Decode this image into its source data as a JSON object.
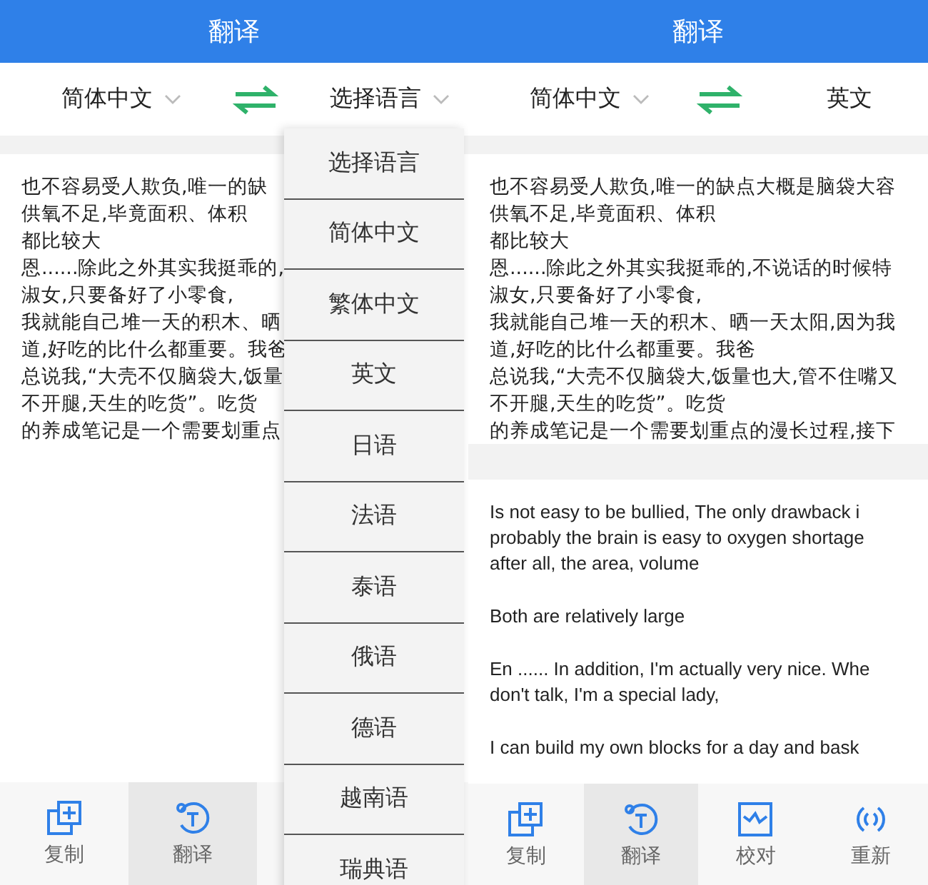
{
  "screens": [
    {
      "title": "翻译",
      "source_lang": {
        "label": "简体中文",
        "chevron": true
      },
      "target_lang": {
        "label": "选择语言",
        "chevron": true
      },
      "source_lines": [
        "也不容易受人欺负,唯一的缺",
        "供氧不足,毕竟面积、体积",
        "都比较大",
        "恩......除此之外其实我挺乖的,",
        "淑女,只要备好了小零食,",
        "我就能自己堆一天的积木、晒",
        "道,好吃的比什么都重要。我爸",
        "总说我,“大壳不仅脑袋大,饭量",
        "不开腿,天生的吃货”。吃货",
        "的养成笔记是一个需要划重点"
      ],
      "nav": [
        {
          "kind": "copy",
          "label": "复制",
          "selected": false
        },
        {
          "kind": "translate",
          "label": "翻译",
          "selected": true
        }
      ],
      "dropdown": [
        "选择语言",
        "简体中文",
        "繁体中文",
        "英文",
        "日语",
        "法语",
        "泰语",
        "俄语",
        "德语",
        "越南语",
        "瑞典语"
      ]
    },
    {
      "title": "翻译",
      "source_lang": {
        "label": "简体中文",
        "chevron": true
      },
      "target_lang": {
        "label": "英文",
        "chevron": false
      },
      "source_lines": [
        "也不容易受人欺负,唯一的缺点大概是脑袋大容",
        "供氧不足,毕竟面积、体积",
        "都比较大",
        "恩......除此之外其实我挺乖的,不说话的时候特",
        "淑女,只要备好了小零食,",
        "我就能自己堆一天的积木、晒一天太阳,因为我",
        "道,好吃的比什么都重要。我爸",
        "总说我,“大壳不仅脑袋大,饭量也大,管不住嘴又",
        "不开腿,天生的吃货”。吃货",
        "的养成笔记是一个需要划重点的漫长过程,接下"
      ],
      "translation_paragraphs": [
        [
          "Is not easy to be bullied, The only drawback i",
          "probably the brain is easy to oxygen shortage",
          "after all, the area, volume"
        ],
        [
          "Both are relatively large"
        ],
        [
          "En ...... In addition, I'm actually very nice. Whe",
          "don't talk, I'm a special lady,"
        ],
        [
          "I can build my own blocks for a day and bask"
        ]
      ],
      "nav": [
        {
          "kind": "copy",
          "label": "复制",
          "selected": false
        },
        {
          "kind": "translate",
          "label": "翻译",
          "selected": true
        },
        {
          "kind": "proofread",
          "label": "校对",
          "selected": false
        },
        {
          "kind": "voice",
          "label": "重新",
          "selected": false
        }
      ]
    }
  ]
}
